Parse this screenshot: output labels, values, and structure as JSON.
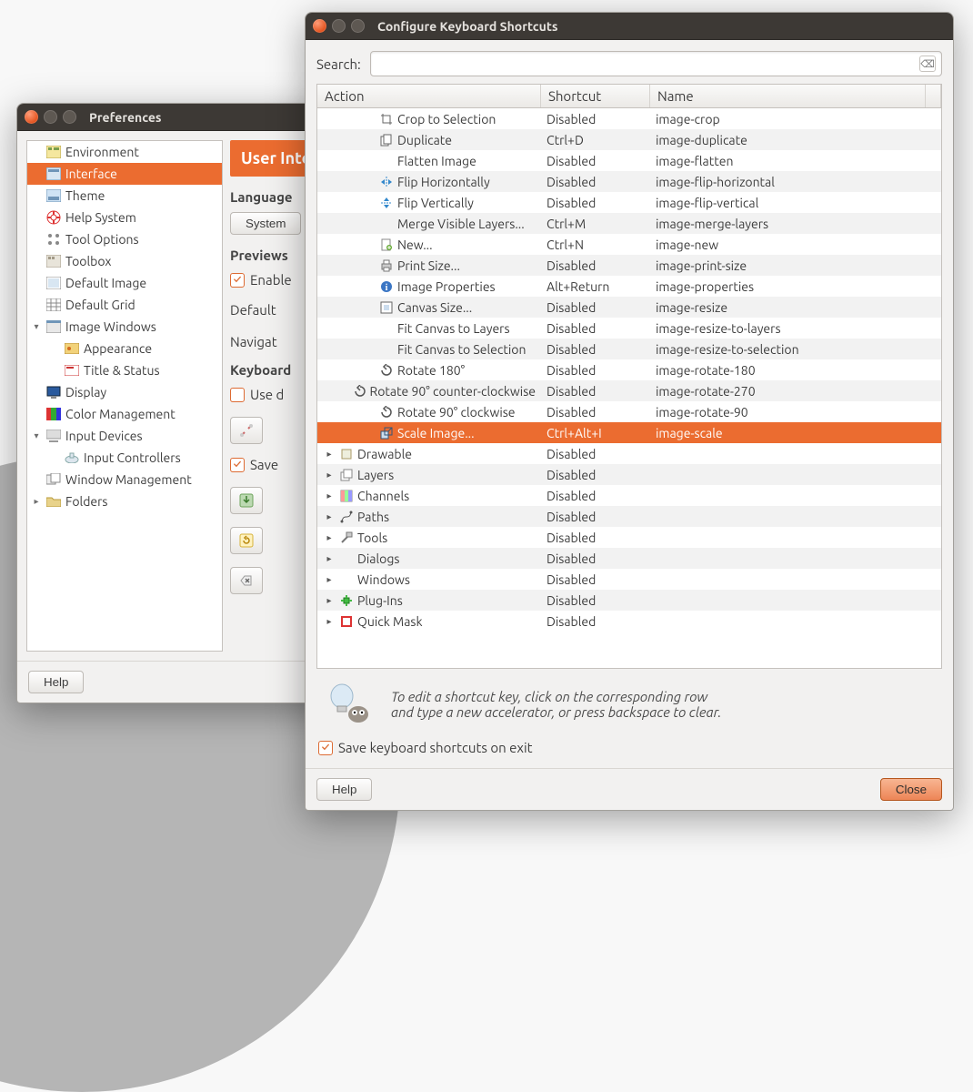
{
  "prefs": {
    "title": "Preferences",
    "sidebar": [
      {
        "label": "Environment",
        "icon": "env"
      },
      {
        "label": "Interface",
        "icon": "interface",
        "selected": true
      },
      {
        "label": "Theme",
        "icon": "theme"
      },
      {
        "label": "Help System",
        "icon": "help"
      },
      {
        "label": "Tool Options",
        "icon": "toolopts"
      },
      {
        "label": "Toolbox",
        "icon": "toolbox"
      },
      {
        "label": "Default Image",
        "icon": "defimage"
      },
      {
        "label": "Default Grid",
        "icon": "grid"
      },
      {
        "label": "Image Windows",
        "icon": "imgwin",
        "expander": "▾"
      },
      {
        "label": "Appearance",
        "icon": "appearance",
        "indent": 1
      },
      {
        "label": "Title & Status",
        "icon": "title",
        "indent": 1
      },
      {
        "label": "Display",
        "icon": "display"
      },
      {
        "label": "Color Management",
        "icon": "colormgmt"
      },
      {
        "label": "Input Devices",
        "icon": "inputdev",
        "expander": "▾"
      },
      {
        "label": "Input Controllers",
        "icon": "inputctrl",
        "indent": 1
      },
      {
        "label": "Window Management",
        "icon": "winmgmt"
      },
      {
        "label": "Folders",
        "icon": "folders",
        "expander": "▸"
      }
    ],
    "header": "User Interface",
    "lang_label": "Language",
    "lang_button": "System",
    "previews_label": "Previews",
    "enable_label": "Enable",
    "default_label": "Default",
    "navigat_label": "Navigat",
    "keyboard_label": "Keyboard",
    "use_label": "Use d",
    "save_label": "Save",
    "help_button": "Help"
  },
  "dialog": {
    "title": "Configure Keyboard Shortcuts",
    "search_label": "Search:",
    "columns": {
      "action": "Action",
      "shortcut": "Shortcut",
      "name": "Name"
    },
    "rows": [
      {
        "indent": 2,
        "icon": "crop",
        "action": "Crop to Selection",
        "shortcut": "Disabled",
        "name": "image-crop"
      },
      {
        "indent": 2,
        "icon": "duplicate",
        "action": "Duplicate",
        "shortcut": "Ctrl+D",
        "name": "image-duplicate"
      },
      {
        "indent": 2,
        "icon": "",
        "action": "Flatten Image",
        "shortcut": "Disabled",
        "name": "image-flatten"
      },
      {
        "indent": 2,
        "icon": "flip-h",
        "action": "Flip Horizontally",
        "shortcut": "Disabled",
        "name": "image-flip-horizontal"
      },
      {
        "indent": 2,
        "icon": "flip-v",
        "action": "Flip Vertically",
        "shortcut": "Disabled",
        "name": "image-flip-vertical"
      },
      {
        "indent": 2,
        "icon": "",
        "action": "Merge Visible Layers...",
        "shortcut": "Ctrl+M",
        "name": "image-merge-layers"
      },
      {
        "indent": 2,
        "icon": "new",
        "action": "New...",
        "shortcut": "Ctrl+N",
        "name": "image-new"
      },
      {
        "indent": 2,
        "icon": "print",
        "action": "Print Size...",
        "shortcut": "Disabled",
        "name": "image-print-size"
      },
      {
        "indent": 2,
        "icon": "info",
        "action": "Image Properties",
        "shortcut": "Alt+Return",
        "name": "image-properties"
      },
      {
        "indent": 2,
        "icon": "canvas",
        "action": "Canvas Size...",
        "shortcut": "Disabled",
        "name": "image-resize"
      },
      {
        "indent": 2,
        "icon": "",
        "action": "Fit Canvas to Layers",
        "shortcut": "Disabled",
        "name": "image-resize-to-layers"
      },
      {
        "indent": 2,
        "icon": "",
        "action": "Fit Canvas to Selection",
        "shortcut": "Disabled",
        "name": "image-resize-to-selection"
      },
      {
        "indent": 2,
        "icon": "rotate",
        "action": "Rotate 180°",
        "shortcut": "Disabled",
        "name": "image-rotate-180"
      },
      {
        "indent": 2,
        "icon": "rotate",
        "action": "Rotate 90° counter-clockwise",
        "shortcut": "Disabled",
        "name": "image-rotate-270"
      },
      {
        "indent": 2,
        "icon": "rotate",
        "action": "Rotate 90° clockwise",
        "shortcut": "Disabled",
        "name": "image-rotate-90"
      },
      {
        "indent": 2,
        "icon": "scale",
        "action": "Scale Image...",
        "shortcut": "Ctrl+Alt+I",
        "name": "image-scale",
        "selected": true
      },
      {
        "indent": 0,
        "exp": "▸",
        "icon": "drawable",
        "action": "Drawable",
        "shortcut": "Disabled",
        "name": ""
      },
      {
        "indent": 0,
        "exp": "▸",
        "icon": "layers",
        "action": "Layers",
        "shortcut": "Disabled",
        "name": ""
      },
      {
        "indent": 0,
        "exp": "▸",
        "icon": "channels",
        "action": "Channels",
        "shortcut": "Disabled",
        "name": ""
      },
      {
        "indent": 0,
        "exp": "▸",
        "icon": "paths",
        "action": "Paths",
        "shortcut": "Disabled",
        "name": ""
      },
      {
        "indent": 0,
        "exp": "▸",
        "icon": "tools",
        "action": "Tools",
        "shortcut": "Disabled",
        "name": ""
      },
      {
        "indent": 0,
        "exp": "▸",
        "icon": "",
        "action": "Dialogs",
        "shortcut": "Disabled",
        "name": ""
      },
      {
        "indent": 0,
        "exp": "▸",
        "icon": "",
        "action": "Windows",
        "shortcut": "Disabled",
        "name": ""
      },
      {
        "indent": 0,
        "exp": "▸",
        "icon": "plugins",
        "action": "Plug-Ins",
        "shortcut": "Disabled",
        "name": ""
      },
      {
        "indent": 0,
        "exp": "▸",
        "icon": "quickmask",
        "action": "Quick Mask",
        "shortcut": "Disabled",
        "name": ""
      }
    ],
    "hint_line1": "To edit a shortcut key, click on the corresponding row",
    "hint_line2": "and type a new accelerator, or press backspace to clear.",
    "save_shortcuts_label": "Save keyboard shortcuts on exit",
    "help_button": "Help",
    "close_button": "Close"
  }
}
